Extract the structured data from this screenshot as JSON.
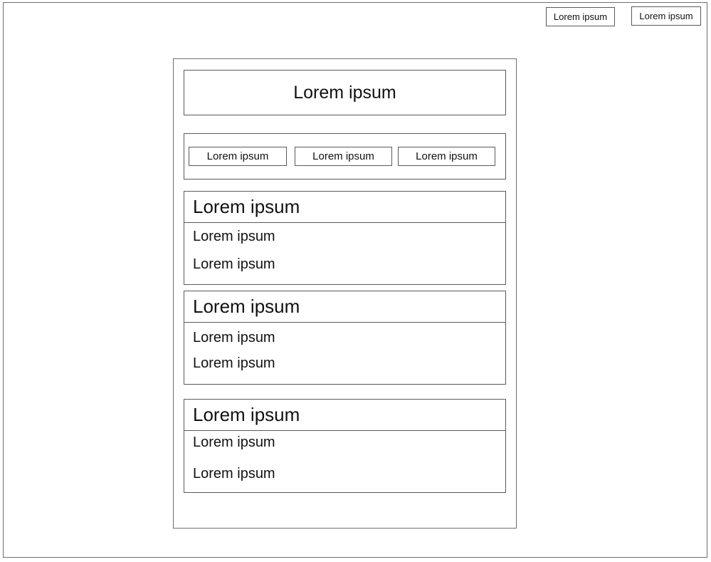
{
  "header": {
    "buttons": [
      {
        "label": "Lorem ipsum"
      },
      {
        "label": "Lorem ipsum"
      }
    ]
  },
  "panel": {
    "title": "Lorem ipsum",
    "tabs": [
      {
        "label": "Lorem ipsum"
      },
      {
        "label": "Lorem ipsum"
      },
      {
        "label": "Lorem ipsum"
      }
    ],
    "sections": [
      {
        "heading": "Lorem ipsum",
        "items": [
          "Lorem ipsum",
          "Lorem ipsum"
        ]
      },
      {
        "heading": "Lorem ipsum",
        "items": [
          "Lorem ipsum",
          "Lorem ipsum"
        ]
      },
      {
        "heading": "Lorem ipsum",
        "items": [
          "Lorem ipsum",
          "Lorem ipsum"
        ]
      }
    ]
  }
}
